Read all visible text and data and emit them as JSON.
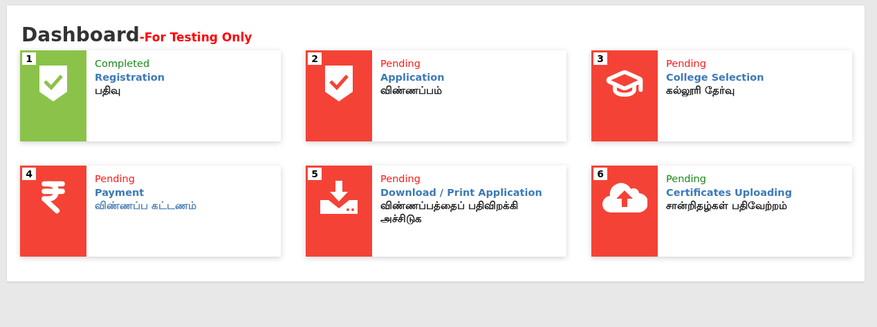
{
  "heading": {
    "title": "Dashboard",
    "note": "-For Testing Only"
  },
  "cards": [
    {
      "number": "1",
      "kind": "shield",
      "color": "#8bc34a",
      "status": {
        "text": "Completed",
        "color": "#1a8a1a"
      },
      "title": "Registration",
      "subtitle": {
        "text": "பதிவு",
        "color": "#111111"
      }
    },
    {
      "number": "2",
      "kind": "shield",
      "color": "#f44336",
      "status": {
        "text": "Pending",
        "color": "#ff1a1a"
      },
      "title": "Application",
      "subtitle": {
        "text": "விண்ணப்பம்",
        "color": "#111111"
      }
    },
    {
      "number": "3",
      "kind": "cap",
      "color": "#f44336",
      "status": {
        "text": "Pending",
        "color": "#ff1a1a"
      },
      "title": "College Selection",
      "subtitle": {
        "text": "கல்லூரி தேர்வு",
        "color": "#111111"
      }
    },
    {
      "number": "4",
      "kind": "rupee",
      "color": "#f44336",
      "status": {
        "text": "Pending",
        "color": "#ff1a1a"
      },
      "title": "Payment",
      "subtitle": {
        "text": "விண்ணப்ப கட்டணம்",
        "color": "#4a7fb5"
      }
    },
    {
      "number": "5",
      "kind": "download",
      "color": "#f44336",
      "status": {
        "text": "Pending",
        "color": "#ff1a1a"
      },
      "title": "Download / Print Application",
      "subtitle": {
        "text": "விண்ணப்பத்தைப் பதிவிறக்கி அச்சிடுக",
        "color": "#111111"
      }
    },
    {
      "number": "6",
      "kind": "upload",
      "color": "#f44336",
      "status": {
        "text": "Pending",
        "color": "#1a8a1a"
      },
      "title": "Certificates Uploading",
      "subtitle": {
        "text": "சான்றிதழ்கள் பதிவேற்றம்",
        "color": "#111111"
      }
    }
  ]
}
